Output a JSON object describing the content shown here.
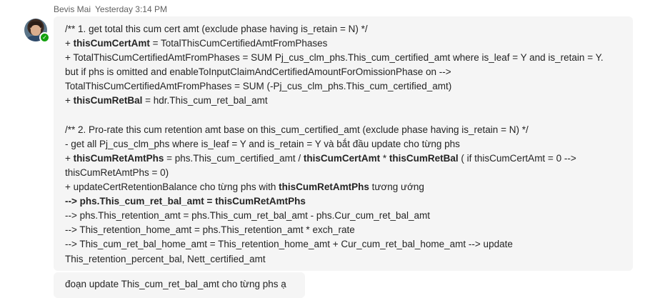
{
  "message": {
    "sender": "Bevis Mai",
    "timestamp": "Yesterday 3:14 PM",
    "lines": [
      [
        {
          "t": "/** 1. get total this cum cert amt (exclude phase having is_retain = N) */"
        }
      ],
      [
        {
          "t": "+ "
        },
        {
          "t": "thisCumCertAmt",
          "b": true
        },
        {
          "t": " = TotalThisCumCertifiedAmtFromPhases"
        }
      ],
      [
        {
          "t": "+ TotalThisCumCertifiedAmtFromPhases = SUM Pj_cus_clm_phs.This_cum_certified_amt where is_leaf = Y and is_retain = Y."
        }
      ],
      [
        {
          "t": "but if phs is omitted and enableToInputClaimAndCertifiedAmountForOmissionPhase on -->"
        }
      ],
      [
        {
          "t": "TotalThisCumCertifiedAmtFromPhases = SUM (-Pj_cus_clm_phs.This_cum_certified_amt)"
        }
      ],
      [
        {
          "t": "+ "
        },
        {
          "t": "thisCumRetBal",
          "b": true
        },
        {
          "t": " = hdr.This_cum_ret_bal_amt"
        }
      ],
      [],
      [
        {
          "t": "/** 2. Pro-rate this cum retention amt base on this_cum_certified_amt (exclude phase having is_retain = N) */"
        }
      ],
      [
        {
          "t": "- get all Pj_cus_clm_phs where is_leaf = Y and is_retain = Y và bắt đầu update cho từng phs"
        }
      ],
      [
        {
          "t": "+ "
        },
        {
          "t": "thisCumRetAmtPhs",
          "b": true
        },
        {
          "t": " = phs.This_cum_certified_amt / "
        },
        {
          "t": "thisCumCertAmt",
          "b": true
        },
        {
          "t": " * "
        },
        {
          "t": "thisCumRetBal",
          "b": true
        },
        {
          "t": " ( if thisCumCertAmt = 0 -->"
        }
      ],
      [
        {
          "t": "thisCumRetAmtPhs = 0)"
        }
      ],
      [
        {
          "t": "+ updateCertRetentionBalance cho từng phs with "
        },
        {
          "t": "thisCumRetAmtPhs",
          "b": true
        },
        {
          "t": " tương ướng"
        }
      ],
      [
        {
          "t": "--> phs.This_cum_ret_bal_amt = thisCumRetAmtPhs",
          "b": true
        }
      ],
      [
        {
          "t": "--> phs.This_retention_amt = phs.This_cum_ret_bal_amt - phs.Cur_cum_ret_bal_amt"
        }
      ],
      [
        {
          "t": "--> This_retention_home_amt = phs.This_retention_amt * exch_rate"
        }
      ],
      [
        {
          "t": "--> This_cum_ret_bal_home_amt = This_retention_home_amt + Cur_cum_ret_bal_home_amt --> update"
        }
      ],
      [
        {
          "t": "This_retention_percent_bal, Nett_certified_amt"
        }
      ]
    ]
  },
  "reply": {
    "text": "đoạn  update This_cum_ret_bal_amt cho từng phs ạ"
  },
  "presence_color": "#13a10e"
}
